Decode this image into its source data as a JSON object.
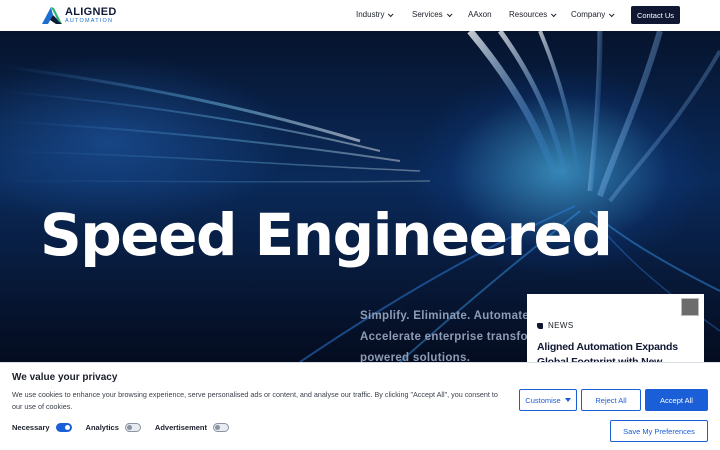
{
  "header": {
    "logo_main": "ALIGNED",
    "logo_sub": "AUTOMATION",
    "nav": [
      {
        "label": "Industry",
        "has_dropdown": true
      },
      {
        "label": "Services",
        "has_dropdown": true
      },
      {
        "label": "AAxon",
        "has_dropdown": false
      },
      {
        "label": "Resources",
        "has_dropdown": true
      },
      {
        "label": "Company",
        "has_dropdown": true
      }
    ],
    "contact_label": "Contact Us"
  },
  "hero": {
    "title": "Speed Engineered",
    "subtitle_lines": [
      "Simplify. Eliminate. Automate.",
      "Accelerate enterprise transform",
      "powered solutions."
    ]
  },
  "news": {
    "tag": "NEWS",
    "title": "Aligned Automation Expands Global Footprint with New Operations in"
  },
  "cookie": {
    "title": "We value your privacy",
    "text": "We use cookies to enhance your browsing experience, serve personalised ads or content, and analyse our traffic. By clicking \"Accept All\", you consent to our use of cookies.",
    "toggles": [
      {
        "label": "Necessary",
        "on": true
      },
      {
        "label": "Analytics",
        "on": false
      },
      {
        "label": "Advertisement",
        "on": false
      }
    ],
    "customise_label": "Customise",
    "reject_label": "Reject All",
    "accept_label": "Accept All",
    "save_label": "Save My Preferences"
  },
  "colors": {
    "navy": "#0f1733",
    "accent_blue": "#1b5fd8",
    "logo_blue": "#1c6fd1",
    "logo_green": "#2bb673"
  }
}
